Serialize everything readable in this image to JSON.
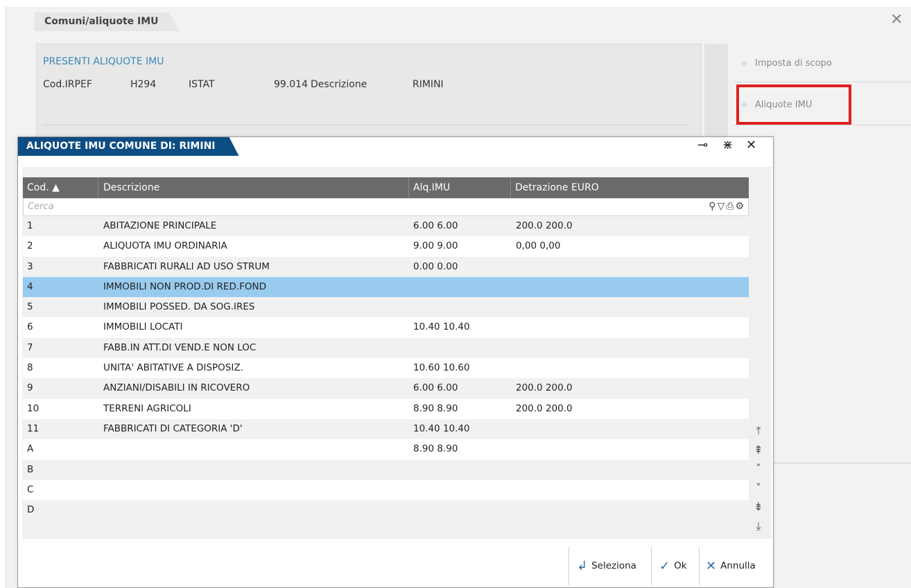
{
  "background": {
    "tab_title": "Comuni/aliquote IMU",
    "heading": "PRESENTI ALIQUOTE IMU",
    "fields": {
      "cod_irpef_label": "Cod.IRPEF",
      "cod_irpef_value": "H294",
      "istat_label": "ISTAT",
      "istat_value": "99.014",
      "descrizione_label": "Descrizione",
      "descrizione_value": "RIMINI"
    },
    "side_items": [
      "Imposta di scopo",
      "Aliquote IMU"
    ]
  },
  "dialog": {
    "title": "ALIQUOTE IMU COMUNE DI: RIMINI",
    "columns": [
      "Cod. ▲",
      "Descrizione",
      "Alq.IMU",
      "Detrazione EURO"
    ],
    "search_placeholder": "Cerca",
    "rows": [
      {
        "cod": "1",
        "desc": "ABITAZIONE PRINCIPALE",
        "alq": "6.00 6.00",
        "detr": "200.0 200.0"
      },
      {
        "cod": "2",
        "desc": "ALIQUOTA IMU ORDINARIA",
        "alq": "9.00 9.00",
        "detr": "0,00 0,00"
      },
      {
        "cod": "3",
        "desc": "FABBRICATI RURALI AD USO STRUM",
        "alq": "0.00 0.00",
        "detr": ""
      },
      {
        "cod": "4",
        "desc": "IMMOBILI NON PROD.DI RED.FOND",
        "alq": "",
        "detr": ""
      },
      {
        "cod": "5",
        "desc": "IMMOBILI POSSED. DA SOG.IRES",
        "alq": "",
        "detr": ""
      },
      {
        "cod": "6",
        "desc": "IMMOBILI LOCATI",
        "alq": "10.40 10.40",
        "detr": ""
      },
      {
        "cod": "7",
        "desc": "FABB.IN ATT.DI VEND.E NON LOC",
        "alq": "",
        "detr": ""
      },
      {
        "cod": "8",
        "desc": "UNITA' ABITATIVE A DISPOSIZ.",
        "alq": "10.60 10.60",
        "detr": ""
      },
      {
        "cod": "9",
        "desc": "ANZIANI/DISABILI IN RICOVERO",
        "alq": "6.00 6.00",
        "detr": "200.0 200.0"
      },
      {
        "cod": "10",
        "desc": "TERRENI AGRICOLI",
        "alq": "8.90 8.90",
        "detr": "200.0 200.0"
      },
      {
        "cod": "11",
        "desc": "FABBRICATI DI CATEGORIA 'D'",
        "alq": "10.40 10.40",
        "detr": ""
      },
      {
        "cod": "A",
        "desc": "",
        "alq": "8.90 8.90",
        "detr": ""
      },
      {
        "cod": "B",
        "desc": "",
        "alq": "",
        "detr": ""
      },
      {
        "cod": "C",
        "desc": "",
        "alq": "",
        "detr": ""
      },
      {
        "cod": "D",
        "desc": "",
        "alq": "",
        "detr": ""
      }
    ],
    "selected_row": "4",
    "buttons": {
      "seleziona": "Seleziona",
      "ok": "Ok",
      "annulla": "Annulla"
    }
  }
}
